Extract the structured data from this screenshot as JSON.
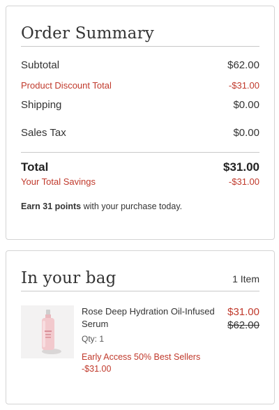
{
  "summary": {
    "title": "Order Summary",
    "subtotal_label": "Subtotal",
    "subtotal_value": "$62.00",
    "discount_label": "Product Discount Total",
    "discount_value": "-$31.00",
    "shipping_label": "Shipping",
    "shipping_value": "$0.00",
    "tax_label": "Sales Tax",
    "tax_value": "$0.00",
    "total_label": "Total",
    "total_value": "$31.00",
    "savings_label": "Your Total Savings",
    "savings_value": "-$31.00",
    "points_bold": "Earn 31 points",
    "points_rest": " with your purchase today."
  },
  "bag": {
    "title": "In your bag",
    "count": "1 Item",
    "items": [
      {
        "name": "Rose Deep Hydration Oil-Infused Serum",
        "qty": "Qty: 1",
        "promo": "Early Access 50% Best Sellers",
        "promo_amount": "-$31.00",
        "price": "$31.00",
        "original_price": "$62.00",
        "image": "rose-serum-bottle"
      }
    ]
  },
  "colors": {
    "accent_red": "#c0392b",
    "text": "#333333",
    "border": "#d4d4d4"
  }
}
